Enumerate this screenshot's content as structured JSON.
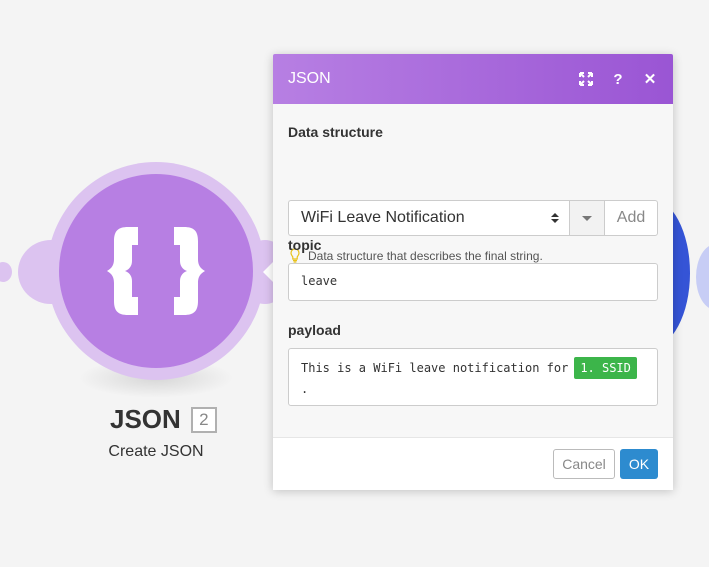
{
  "module": {
    "name": "JSON",
    "badge": "2",
    "subtitle": "Create JSON",
    "icon": "braces-icon",
    "color": "#b77fe3"
  },
  "dialog": {
    "title": "JSON",
    "header_icons": [
      "expand-icon",
      "help-icon",
      "close-icon"
    ],
    "data_structure": {
      "label": "Data structure",
      "selected": "WiFi Leave Notification",
      "add_label": "Add",
      "hint": "Data structure that describes the final string."
    },
    "topic": {
      "label": "topic",
      "value": "leave"
    },
    "payload": {
      "label": "payload",
      "text": "This is a WiFi leave notification for",
      "token": "1. SSID",
      "suffix": "."
    },
    "footer": {
      "cancel_label": "Cancel",
      "ok_label": "OK"
    }
  },
  "colors": {
    "header_start": "#b77fe3",
    "header_end": "#9a55d4",
    "ok_button": "#2d8bcf",
    "token_pill": "#3cb54a",
    "next_module": "#3554d6"
  }
}
